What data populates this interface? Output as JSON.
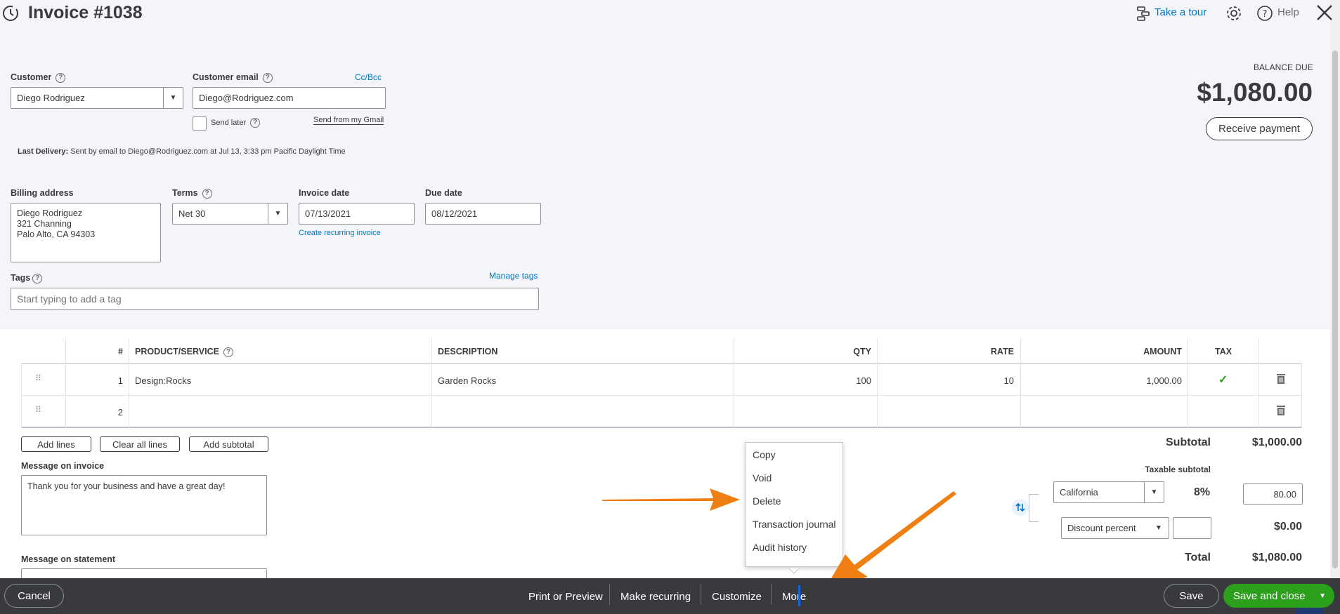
{
  "header": {
    "title": "Invoice #1038",
    "take_tour": "Take a tour",
    "help": "Help"
  },
  "customer": {
    "label": "Customer",
    "value": "Diego Rodriguez"
  },
  "email": {
    "label": "Customer email",
    "value": "Diego@Rodriguez.com",
    "cc_bcc": "Cc/Bcc",
    "send_later": "Send later",
    "send_gmail": "Send from my Gmail"
  },
  "last_delivery": {
    "label": "Last Delivery:",
    "text": "Sent by email to Diego@Rodriguez.com at Jul 13, 3:33 pm Pacific Daylight Time"
  },
  "balance": {
    "label": "BALANCE DUE",
    "amount": "$1,080.00",
    "receive_payment": "Receive payment"
  },
  "billing": {
    "label": "Billing address",
    "line1": "Diego Rodriguez",
    "line2": "321 Channing",
    "line3": "Palo Alto, CA  94303"
  },
  "terms": {
    "label": "Terms",
    "value": "Net 30"
  },
  "invoice_date": {
    "label": "Invoice date",
    "value": "07/13/2021",
    "recurring_link": "Create recurring invoice"
  },
  "due_date": {
    "label": "Due date",
    "value": "08/12/2021"
  },
  "tags": {
    "label": "Tags",
    "manage": "Manage tags",
    "placeholder": "Start typing to add a tag"
  },
  "table": {
    "headers": {
      "num": "#",
      "product": "PRODUCT/SERVICE",
      "description": "DESCRIPTION",
      "qty": "QTY",
      "rate": "RATE",
      "amount": "AMOUNT",
      "tax": "TAX"
    },
    "rows": [
      {
        "num": "1",
        "product": "Design:Rocks",
        "description": "Garden Rocks",
        "qty": "100",
        "rate": "10",
        "amount": "1,000.00"
      },
      {
        "num": "2",
        "product": "",
        "description": "",
        "qty": "",
        "rate": "",
        "amount": ""
      }
    ]
  },
  "line_buttons": {
    "add_lines": "Add lines",
    "clear_lines": "Clear all lines",
    "add_subtotal": "Add subtotal"
  },
  "message": {
    "invoice_label": "Message on invoice",
    "invoice_text": "Thank you for your business and have a great day!",
    "statement_label": "Message on statement"
  },
  "totals": {
    "subtotal_label": "Subtotal",
    "subtotal_value": "$1,000.00",
    "taxable_label": "Taxable subtotal",
    "tax_region": "California",
    "tax_rate": "8%",
    "tax_amount": "80.00",
    "discount_type": "Discount percent",
    "discount_value": "$0.00",
    "total_label": "Total",
    "total_value": "$1,080.00"
  },
  "more_menu": {
    "items": [
      "Copy",
      "Void",
      "Delete",
      "Transaction journal",
      "Audit history"
    ]
  },
  "footer": {
    "cancel": "Cancel",
    "print_preview": "Print or Preview",
    "make_recurring": "Make recurring",
    "customize": "Customize",
    "more": "More",
    "save": "Save",
    "save_close": "Save and close"
  },
  "colors": {
    "link": "#0077c5",
    "green": "#2ca01c",
    "footer": "#393a3d",
    "annotation_arrow": "#f07f13"
  }
}
